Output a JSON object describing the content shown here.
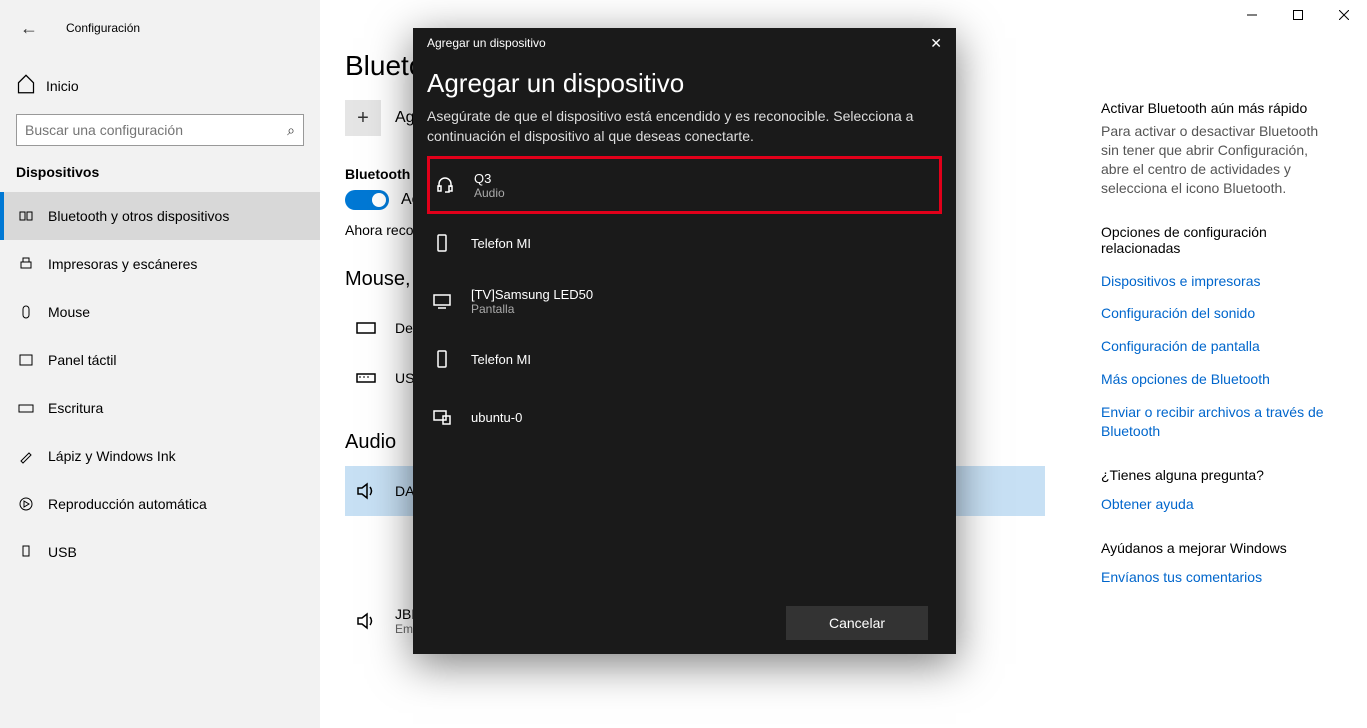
{
  "window": {
    "title": "Configuración"
  },
  "sidebar": {
    "home": "Inicio",
    "search_placeholder": "Buscar una configuración",
    "section": "Dispositivos",
    "items": [
      {
        "label": "Bluetooth y otros dispositivos",
        "active": true
      },
      {
        "label": "Impresoras y escáneres"
      },
      {
        "label": "Mouse"
      },
      {
        "label": "Panel táctil"
      },
      {
        "label": "Escritura"
      },
      {
        "label": "Lápiz y Windows Ink"
      },
      {
        "label": "Reproducción automática"
      },
      {
        "label": "USB"
      }
    ]
  },
  "main": {
    "page_title": "Bluetooth y otros dispositivos",
    "add_label": "Agregar Bluetooth u otro dispositivo",
    "bt_label": "Bluetooth",
    "bt_state": "Activado",
    "now_discoverable": "Ahora reconocible como",
    "cat_mouse": "Mouse, teclado y lápiz",
    "dev_dell": "Dell",
    "dev_usb": "USB",
    "cat_audio": "Audio",
    "dev_da": "DA",
    "dev_jbl": {
      "name": "JBL Xtreme",
      "status": "Emparejado"
    }
  },
  "right": {
    "fast_title": "Activar Bluetooth aún más rápido",
    "fast_desc": "Para activar o desactivar Bluetooth sin tener que abrir Configuración, abre el centro de actividades y selecciona el icono Bluetooth.",
    "related_title": "Opciones de configuración relacionadas",
    "links": [
      "Dispositivos e impresoras",
      "Configuración del sonido",
      "Configuración de pantalla",
      "Más opciones de Bluetooth",
      "Enviar o recibir archivos a través de Bluetooth"
    ],
    "q_title": "¿Tienes alguna pregunta?",
    "q_link": "Obtener ayuda",
    "improve_title": "Ayúdanos a mejorar Windows",
    "improve_link": "Envíanos tus comentarios"
  },
  "dialog": {
    "title": "Agregar un dispositivo",
    "heading": "Agregar un dispositivo",
    "desc": "Asegúrate de que el dispositivo está encendido y es reconocible. Selecciona a continuación el dispositivo al que deseas conectarte.",
    "devices": [
      {
        "name": "Q3",
        "kind": "Audio",
        "type": "headset",
        "highlighted": true
      },
      {
        "name": "Telefon MI",
        "kind": "",
        "type": "phone"
      },
      {
        "name": "[TV]Samsung LED50",
        "kind": "Pantalla",
        "type": "monitor"
      },
      {
        "name": "Telefon MI",
        "kind": "",
        "type": "phone"
      },
      {
        "name": "ubuntu-0",
        "kind": "",
        "type": "computer"
      }
    ],
    "cancel": "Cancelar"
  }
}
